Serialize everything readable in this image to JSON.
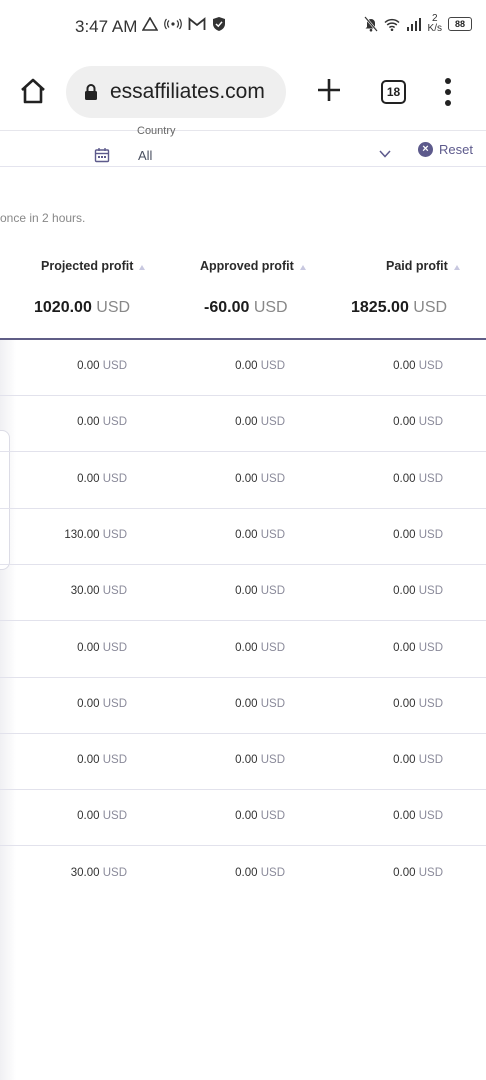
{
  "status_bar": {
    "time": "3:47 AM",
    "net_speed_value": "2",
    "net_speed_unit": "K/s",
    "battery": "88"
  },
  "browser": {
    "url": "essaffiliates.com",
    "tab_count": "18"
  },
  "filters": {
    "country_label": "Country",
    "country_value": "All",
    "reset_label": "Reset"
  },
  "note": "once in 2 hours.",
  "table": {
    "columns": [
      "Projected profit",
      "Approved profit",
      "Paid profit"
    ],
    "totals": [
      {
        "amount": "1020.00",
        "currency": "USD"
      },
      {
        "amount": "-60.00",
        "currency": "USD"
      },
      {
        "amount": "1825.00",
        "currency": "USD"
      }
    ],
    "rows": [
      [
        {
          "amount": "0.00",
          "currency": "USD"
        },
        {
          "amount": "0.00",
          "currency": "USD"
        },
        {
          "amount": "0.00",
          "currency": "USD"
        }
      ],
      [
        {
          "amount": "0.00",
          "currency": "USD"
        },
        {
          "amount": "0.00",
          "currency": "USD"
        },
        {
          "amount": "0.00",
          "currency": "USD"
        }
      ],
      [
        {
          "amount": "0.00",
          "currency": "USD"
        },
        {
          "amount": "0.00",
          "currency": "USD"
        },
        {
          "amount": "0.00",
          "currency": "USD"
        }
      ],
      [
        {
          "amount": "130.00",
          "currency": "USD"
        },
        {
          "amount": "0.00",
          "currency": "USD"
        },
        {
          "amount": "0.00",
          "currency": "USD"
        }
      ],
      [
        {
          "amount": "30.00",
          "currency": "USD"
        },
        {
          "amount": "0.00",
          "currency": "USD"
        },
        {
          "amount": "0.00",
          "currency": "USD"
        }
      ],
      [
        {
          "amount": "0.00",
          "currency": "USD"
        },
        {
          "amount": "0.00",
          "currency": "USD"
        },
        {
          "amount": "0.00",
          "currency": "USD"
        }
      ],
      [
        {
          "amount": "0.00",
          "currency": "USD"
        },
        {
          "amount": "0.00",
          "currency": "USD"
        },
        {
          "amount": "0.00",
          "currency": "USD"
        }
      ],
      [
        {
          "amount": "0.00",
          "currency": "USD"
        },
        {
          "amount": "0.00",
          "currency": "USD"
        },
        {
          "amount": "0.00",
          "currency": "USD"
        }
      ],
      [
        {
          "amount": "0.00",
          "currency": "USD"
        },
        {
          "amount": "0.00",
          "currency": "USD"
        },
        {
          "amount": "0.00",
          "currency": "USD"
        }
      ],
      [
        {
          "amount": "30.00",
          "currency": "USD"
        },
        {
          "amount": "0.00",
          "currency": "USD"
        },
        {
          "amount": "0.00",
          "currency": "USD"
        }
      ]
    ]
  },
  "colors": {
    "accent": "#5d5a8c",
    "header_line": "#5f5d86",
    "row_divider": "#e2e2ec"
  }
}
